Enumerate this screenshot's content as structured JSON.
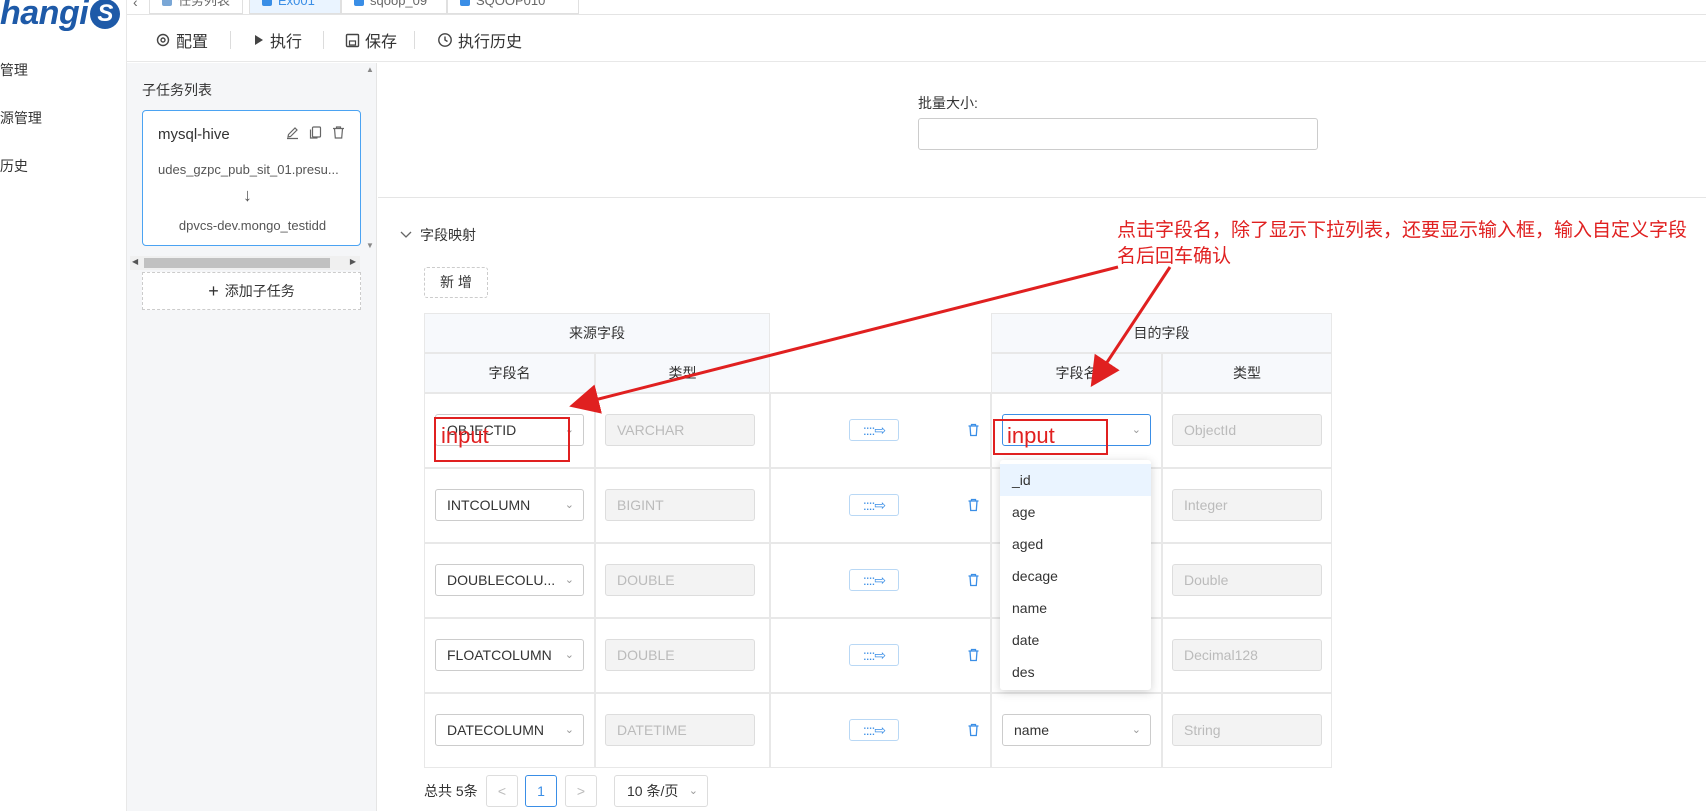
{
  "brand": {
    "logo_text": "hangi",
    "logo_badge": "S"
  },
  "nav": {
    "items": [
      "]管理",
      "]源管理",
      "]历史"
    ]
  },
  "tabs": [
    {
      "label": "任务列表"
    },
    {
      "label": "Ex001"
    },
    {
      "label": "sqoop_09"
    },
    {
      "label": "SQOOP010"
    }
  ],
  "toolbar": {
    "config": "配置",
    "run": "执行",
    "save": "保存",
    "history": "执行历史"
  },
  "subtasks": {
    "title": "子任务列表",
    "card": {
      "name": "mysql-hive",
      "source": "udes_gzpc_pub_sit_01.presu...",
      "target": "dpvcs-dev.mongo_testidd"
    },
    "add_label": "添加子任务"
  },
  "batch": {
    "label": "批量大小:",
    "value": ""
  },
  "mapping": {
    "section_title": "字段映射",
    "add_button": "新 增",
    "headers": {
      "source_group": "来源字段",
      "target_group": "目的字段",
      "src_name": "字段名",
      "src_type": "类型",
      "dst_name": "字段名",
      "dst_type": "类型"
    },
    "rows": [
      {
        "src": "OBJECTID",
        "src_type": "VARCHAR",
        "dst": "input",
        "dst_type": "ObjectId"
      },
      {
        "src": "INTCOLUMN",
        "src_type": "BIGINT",
        "dst": "",
        "dst_type": "Integer"
      },
      {
        "src": "DOUBLECOLU...",
        "src_type": "DOUBLE",
        "dst": "",
        "dst_type": "Double"
      },
      {
        "src": "FLOATCOLUMN",
        "src_type": "DOUBLE",
        "dst": "",
        "dst_type": "Decimal128"
      },
      {
        "src": "DATECOLUMN",
        "src_type": "DATETIME",
        "dst": "name",
        "dst_type": "String"
      }
    ],
    "dropdown_options": [
      "_id",
      "age",
      "aged",
      "decage",
      "name",
      "date",
      "des"
    ]
  },
  "pagination": {
    "total": "总共 5条",
    "page": "1",
    "prev": "<",
    "next": ">",
    "size": "10 条/页"
  },
  "annotation": {
    "label1": "input",
    "label2": "input",
    "note": "点击字段名，除了显示下拉列表，还要显示输入框，输入自定义字段名后回车确认"
  },
  "colors": {
    "accent": "#3a8ee6",
    "annotation": "#e02020",
    "brand": "#1e5aa8"
  }
}
